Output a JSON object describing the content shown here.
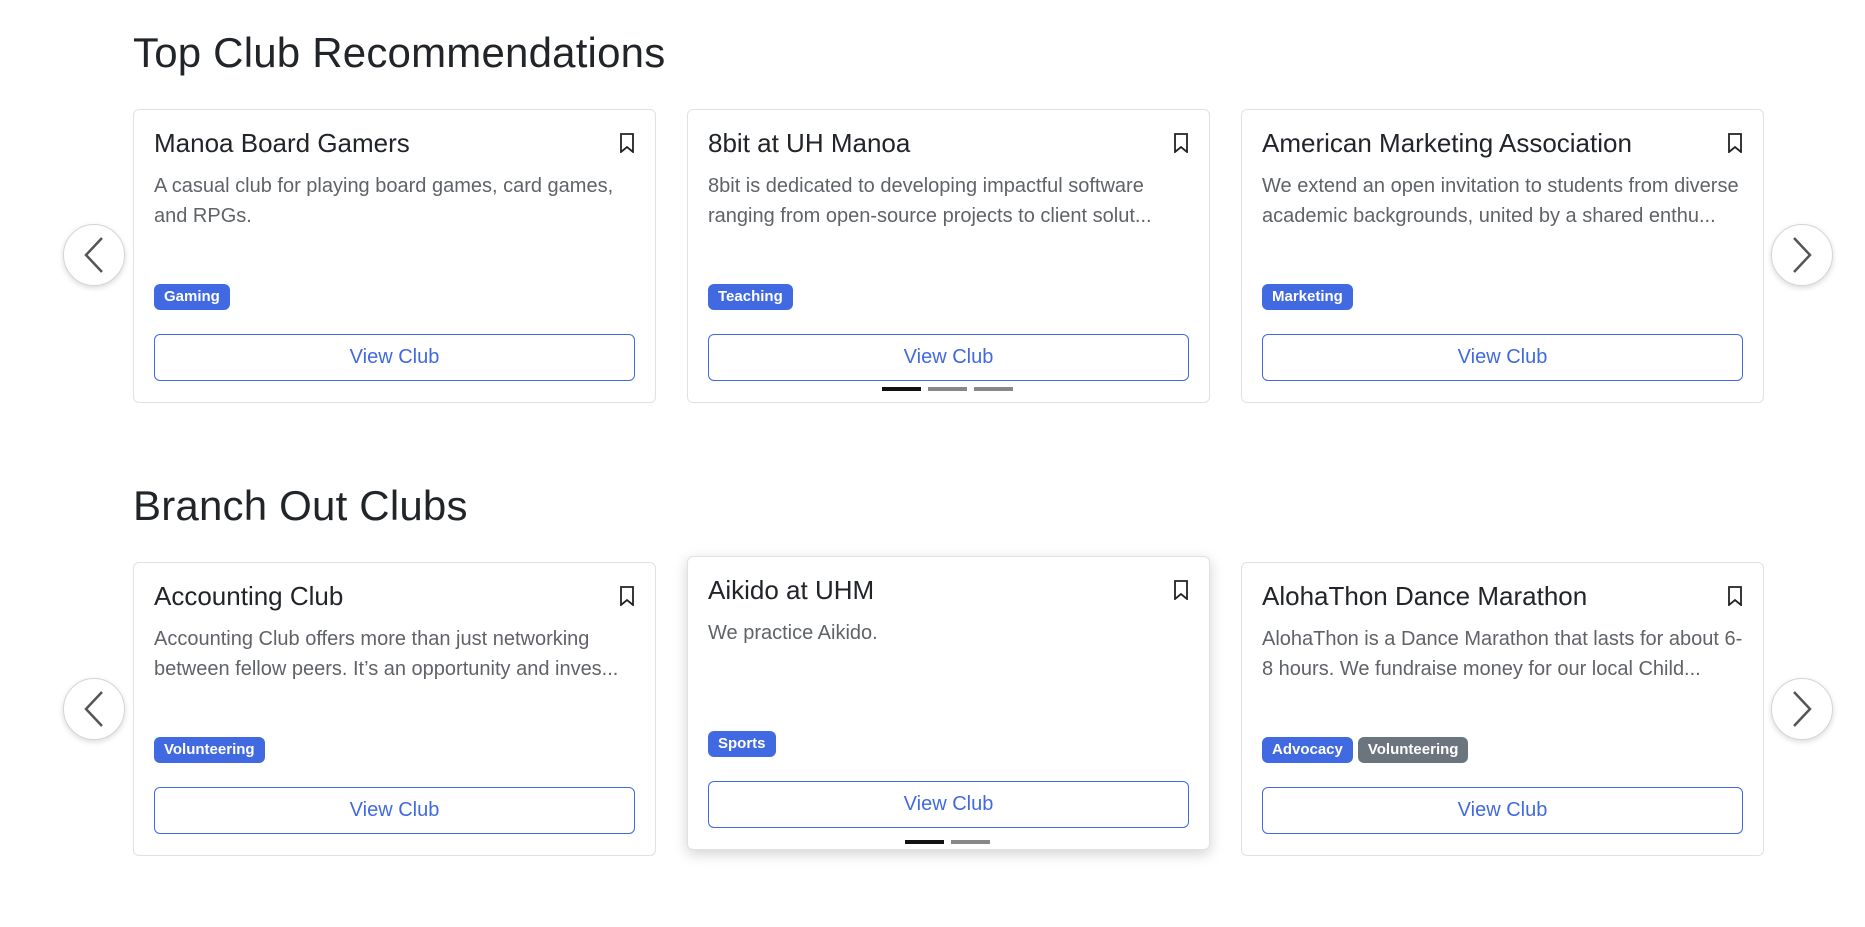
{
  "sections": [
    {
      "title": "Top Club Recommendations",
      "cards": [
        {
          "title": "Manoa Board Gamers",
          "description": "A casual club for playing board games, card games, and RPGs.",
          "tags": [
            {
              "label": "Gaming",
              "color": "#4169e1"
            }
          ],
          "button": "View Club"
        },
        {
          "title": "8bit at UH Manoa",
          "description": "8bit is dedicated to developing impactful software ranging from open-source projects to client solut...",
          "tags": [
            {
              "label": "Teaching",
              "color": "#4169e1"
            }
          ],
          "button": "View Club"
        },
        {
          "title": "American Marketing Association",
          "description": "We extend an open invitation to students from diverse academic backgrounds, united by a shared enthu...",
          "tags": [
            {
              "label": "Marketing",
              "color": "#4169e1"
            }
          ],
          "button": "View Club"
        }
      ],
      "indicators": {
        "count": 3,
        "active": 0
      }
    },
    {
      "title": "Branch Out Clubs",
      "cards": [
        {
          "title": "Accounting Club",
          "description": "Accounting Club offers more than just networking between fellow peers. It’s an opportunity and inves...",
          "tags": [
            {
              "label": "Volunteering",
              "color": "#4169e1"
            }
          ],
          "button": "View Club"
        },
        {
          "title": "Aikido at UHM",
          "description": "We practice Aikido.",
          "tags": [
            {
              "label": "Sports",
              "color": "#4169e1"
            }
          ],
          "button": "View Club"
        },
        {
          "title": "AlohaThon Dance Marathon",
          "description": "AlohaThon is a Dance Marathon that lasts for about 6-8 hours. We fundraise money for our local Child...",
          "tags": [
            {
              "label": "Advocacy",
              "color": "#4169e1"
            },
            {
              "label": "Volunteering",
              "color": "#6c757d"
            }
          ],
          "button": "View Club"
        }
      ],
      "indicators": {
        "count": 2,
        "active": 0
      }
    }
  ],
  "icons": {
    "bookmark": "bookmark-icon",
    "prev": "chevron-left-icon",
    "next": "chevron-right-icon"
  },
  "colors": {
    "accent": "#4169e1",
    "tag_secondary": "#6c757d"
  }
}
